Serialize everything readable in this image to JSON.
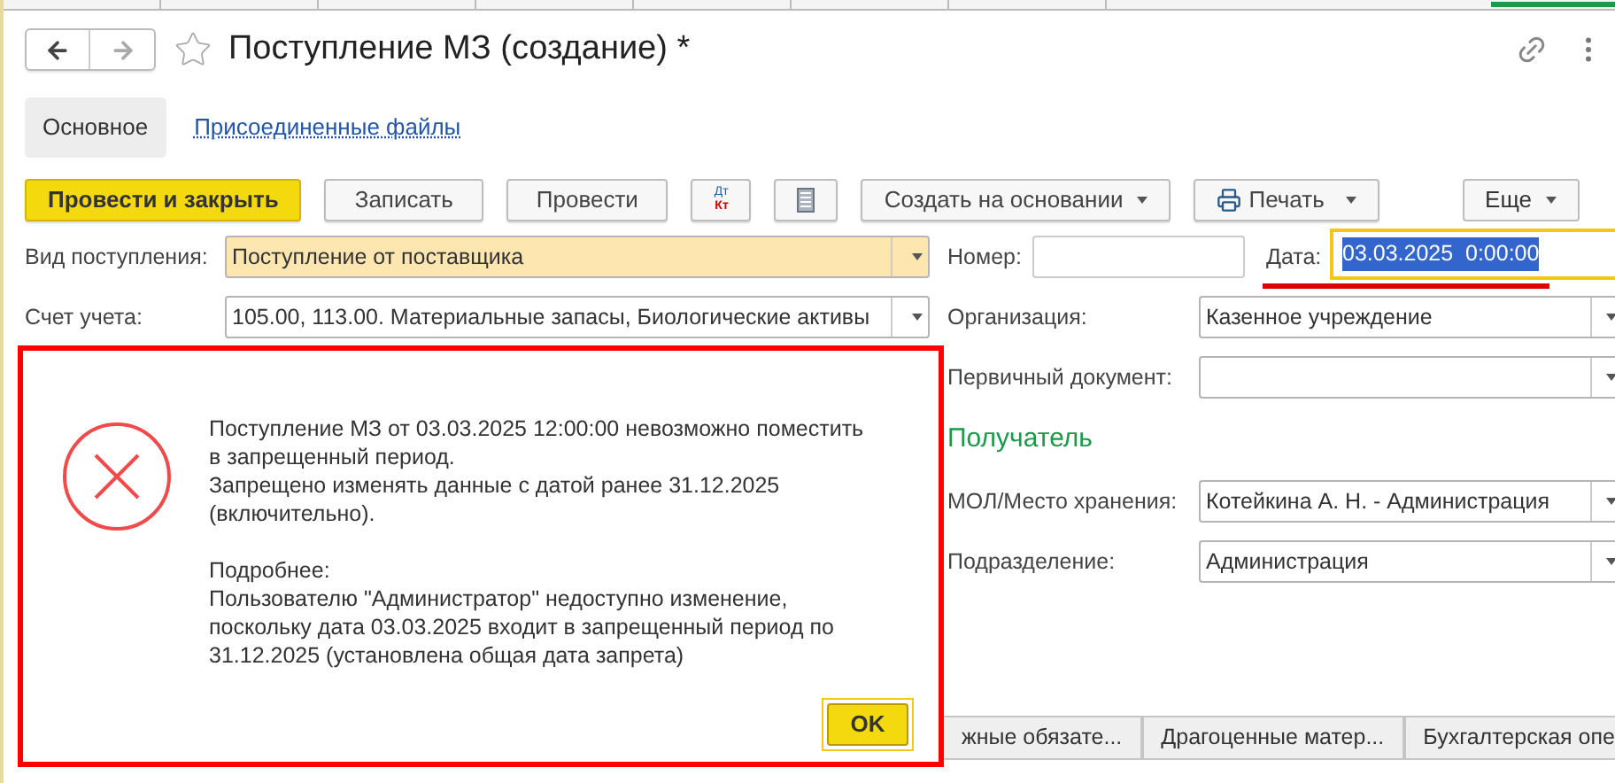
{
  "window": {
    "title": "Поступление МЗ (создание) *",
    "favorite": false
  },
  "tabs": [
    {
      "label": "Основное",
      "selected": true
    },
    {
      "label": "Присоединенные файлы",
      "selected": false
    }
  ],
  "toolbar": [
    {
      "kind": "primary",
      "label": "Провести и закрыть"
    },
    {
      "kind": "plain",
      "label": "Записать"
    },
    {
      "kind": "plain",
      "label": "Провести"
    },
    {
      "kind": "dtkt",
      "label": "Дт",
      "label2": "Кт"
    },
    {
      "kind": "report"
    },
    {
      "kind": "menu",
      "label": "Создать на основании"
    },
    {
      "kind": "print",
      "label": "Печать"
    }
  ],
  "more_button": "Еще",
  "left_fields": [
    {
      "label": "Вид поступления:",
      "value": "Поступление от поставщика",
      "highlighted": true
    },
    {
      "label": "Счет учета:",
      "value": "105.00, 113.00. Материальные запасы, Биологические активы",
      "highlighted": false
    }
  ],
  "number": {
    "label": "Номер:"
  },
  "date": {
    "label": "Дата:",
    "value": "03.03.2025  0:00:00",
    "selected": true
  },
  "right_fields": [
    {
      "kind": "field",
      "label": "Организация:",
      "value": "Казенное учреждение"
    },
    {
      "kind": "field",
      "label": "Первичный документ:"
    },
    {
      "kind": "heading",
      "label": "Получатель"
    },
    {
      "kind": "field",
      "label": "МОЛ/Место хранения:",
      "value": "Котейкина А. Н. - Администрация"
    },
    {
      "kind": "field",
      "label": "Подразделение:",
      "value": "Администрация"
    }
  ],
  "bottom_tabs": [
    "жные обязате...",
    "Драгоценные матер...",
    "Бухгалтерская опе"
  ],
  "dialog": {
    "paragraphs": [
      "Поступление МЗ  от 03.03.2025 12:00:00 невозможно поместить в запрещенный период.\nЗапрещено изменять данные с датой ранее 31.12.2025 (включительно).",
      "Подробнее:\nПользователю \"Администратор\" недоступно изменение, поскольку дата 03.03.2025 входит в запрещенный период по 31.12.2025 (установлена общая дата запрета)"
    ],
    "ok": "OK"
  }
}
